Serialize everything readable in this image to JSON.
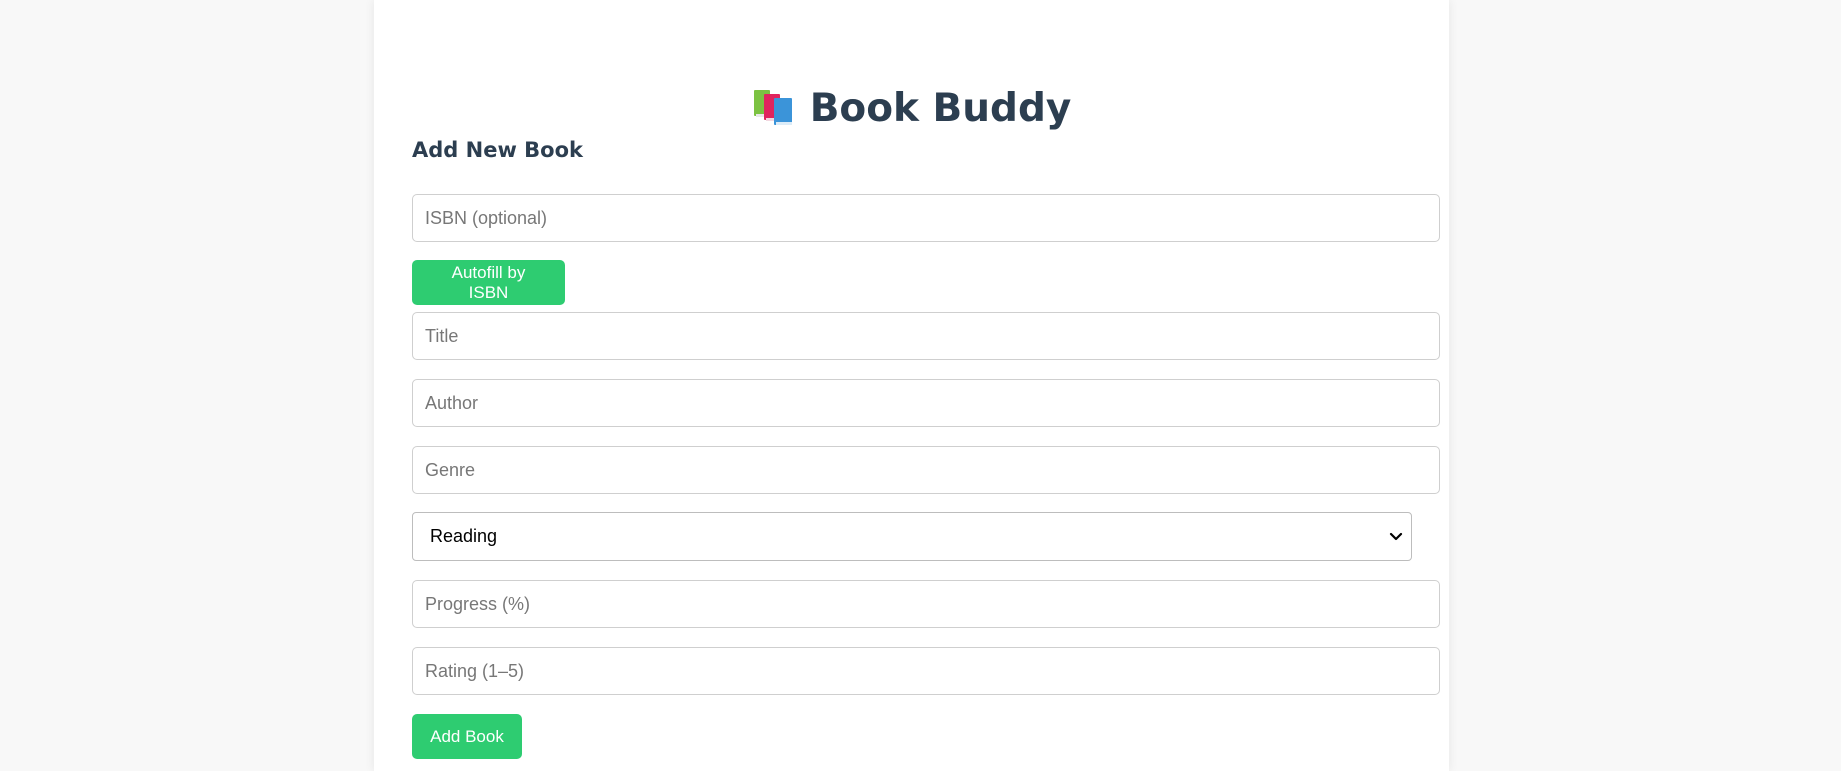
{
  "header": {
    "title": "Book Buddy",
    "icon": "books-icon"
  },
  "form": {
    "heading": "Add New Book",
    "isbn": {
      "placeholder": "ISBN (optional)",
      "value": ""
    },
    "autofill_label": "Autofill by ISBN",
    "title_field": {
      "placeholder": "Title",
      "value": ""
    },
    "author_field": {
      "placeholder": "Author",
      "value": ""
    },
    "genre_field": {
      "placeholder": "Genre",
      "value": ""
    },
    "status": {
      "selected": "Reading",
      "icon": "chevron-down-icon"
    },
    "progress_field": {
      "placeholder": "Progress (%)",
      "value": ""
    },
    "rating_field": {
      "placeholder": "Rating (1–5)",
      "value": ""
    },
    "submit_label": "Add Book"
  },
  "colors": {
    "accent": "#2ecc71",
    "heading": "#2c3e50",
    "background": "#f8f8f8"
  }
}
